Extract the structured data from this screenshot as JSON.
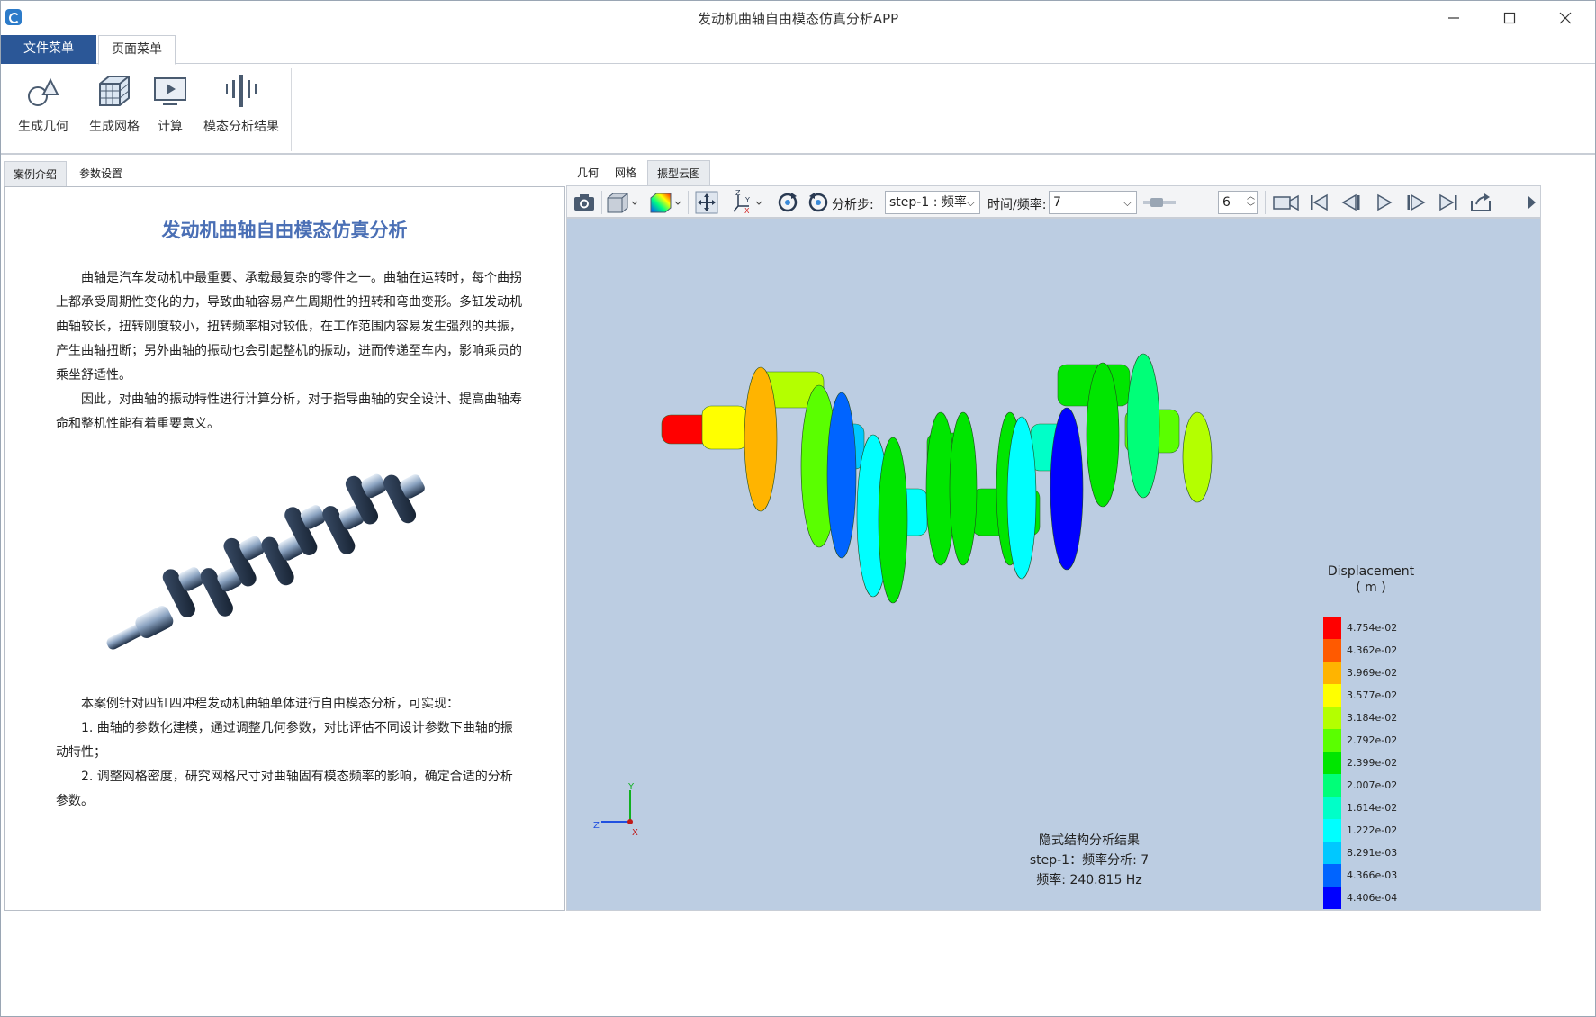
{
  "window": {
    "title": "发动机曲轴自由模态仿真分析APP",
    "icon": "app-logo-icon",
    "controls": [
      "minimize-icon",
      "maximize-icon",
      "close-icon"
    ]
  },
  "menu": {
    "file_label": "文件菜单",
    "page_label": "页面菜单"
  },
  "ribbon": {
    "geometry_label": "生成几何",
    "mesh_label": "生成网格",
    "compute_label": "计算",
    "modal_label": "模态分析结果"
  },
  "left_tabs": {
    "case_label": "案例介绍",
    "param_label": "参数设置"
  },
  "document": {
    "title": "发动机曲轴自由模态仿真分析",
    "para1": "曲轴是汽车发动机中最重要、承载最复杂的零件之一。曲轴在运转时，每个曲拐上都承受周期性变化的力，导致曲轴容易产生周期性的扭转和弯曲变形。多缸发动机曲轴较长，扭转刚度较小，扭转频率相对较低，在工作范围内容易发生强烈的共振，产生曲轴扭断；另外曲轴的振动也会引起整机的振动，进而传递至车内，影响乘员的乘坐舒适性。",
    "para2": "因此，对曲轴的振动特性进行计算分析，对于指导曲轴的安全设计、提高曲轴寿命和整机性能有着重要意义。",
    "para3": "本案例针对四缸四冲程发动机曲轴单体进行自由模态分析，可实现：",
    "para4": "1. 曲轴的参数化建模，通过调整几何参数，对比评估不同设计参数下曲轴的振动特性；",
    "para5": "2. 调整网格密度，研究网格尺寸对曲轴固有模态频率的影响，确定合适的分析参数。"
  },
  "view_tabs": {
    "geometry_label": "几何",
    "mesh_label": "网格",
    "cloud_label": "振型云图"
  },
  "toolbar": {
    "step_label": "分析步:",
    "step_value": "step-1 : 频率",
    "time_label": "时间/频率:",
    "time_value": "7",
    "frame_value": "6"
  },
  "legend": {
    "title": "Displacement",
    "unit": "( m )",
    "entries": [
      {
        "value": "4.754e-02",
        "color": "#ff0000"
      },
      {
        "value": "4.362e-02",
        "color": "#ff5a00"
      },
      {
        "value": "3.969e-02",
        "color": "#ffb400"
      },
      {
        "value": "3.577e-02",
        "color": "#ffff00"
      },
      {
        "value": "3.184e-02",
        "color": "#b4ff00"
      },
      {
        "value": "2.792e-02",
        "color": "#5aff00"
      },
      {
        "value": "2.399e-02",
        "color": "#00e600"
      },
      {
        "value": "2.007e-02",
        "color": "#00ff78"
      },
      {
        "value": "1.614e-02",
        "color": "#00ffc8"
      },
      {
        "value": "1.222e-02",
        "color": "#00ffff"
      },
      {
        "value": "8.291e-03",
        "color": "#00c8ff"
      },
      {
        "value": "4.366e-03",
        "color": "#0064ff"
      },
      {
        "value": "4.406e-04",
        "color": "#0000ff"
      }
    ]
  },
  "result": {
    "line1": "隐式结构分析结果",
    "line2": "step-1：频率分析: 7",
    "line3": "频率:  240.815 Hz"
  },
  "axes": {
    "y_label": "Y",
    "z_label": "Z",
    "x_label": "X"
  }
}
